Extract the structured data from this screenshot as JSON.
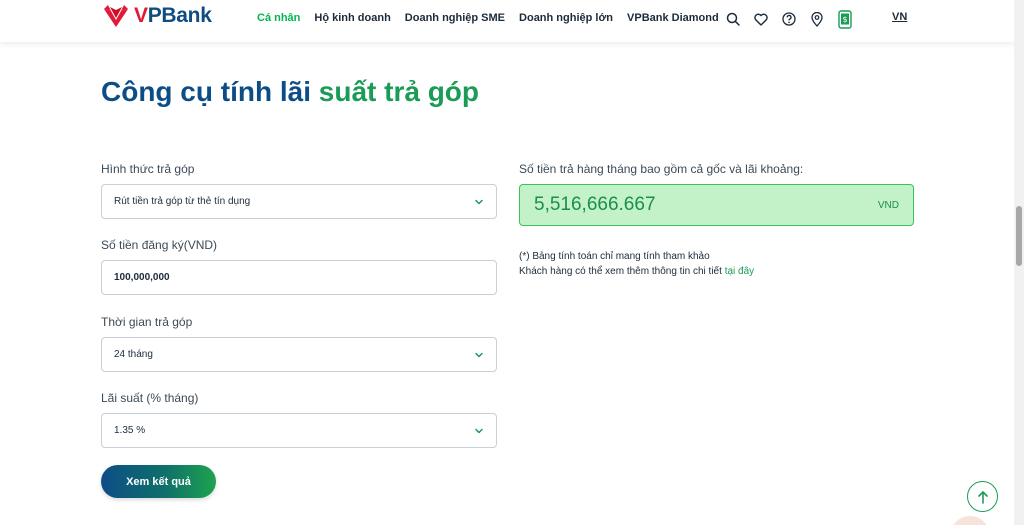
{
  "header": {
    "logo_text_v": "V",
    "logo_text_rest": "PBank",
    "nav": [
      {
        "label": "Cá nhân",
        "active": true
      },
      {
        "label": "Hộ kinh doanh"
      },
      {
        "label": "Doanh nghiệp SME"
      },
      {
        "label": "Doanh nghiệp lớn"
      },
      {
        "label": "VPBank Diamond"
      }
    ],
    "icons": [
      "search-icon",
      "heart-icon",
      "help-icon",
      "location-icon",
      "mobile-app-icon"
    ],
    "lang": "VN"
  },
  "title": {
    "part1": "Công cụ tính lãi",
    "part2": "suất trả góp"
  },
  "form": {
    "installment_type_label": "Hình thức trả góp",
    "installment_type_value": "Rút tiền trả góp từ thẻ tín dụng",
    "amount_label": "Số tiền đăng ký(VND)",
    "amount_value": "100,000,000",
    "period_label": "Thời gian trả góp",
    "period_value": "24 tháng",
    "rate_label": "Lãi suất (% tháng)",
    "rate_value": "1.35 %",
    "submit_label": "Xem kết quả"
  },
  "result": {
    "label": "Số tiền trả hàng tháng bao gồm cả gốc và lãi khoảng:",
    "value": "5,516,666.667",
    "unit": "VND",
    "note1": "(*) Bảng tính toán chỉ mang tính tham khảo",
    "note2_prefix": "Khách hàng có thể xem thêm thông tin chi tiết",
    "note2_link": "tại đây"
  },
  "colors": {
    "brand_blue": "#0d4d87",
    "brand_green": "#1a9c57",
    "result_bg": "#c4f2c8"
  }
}
